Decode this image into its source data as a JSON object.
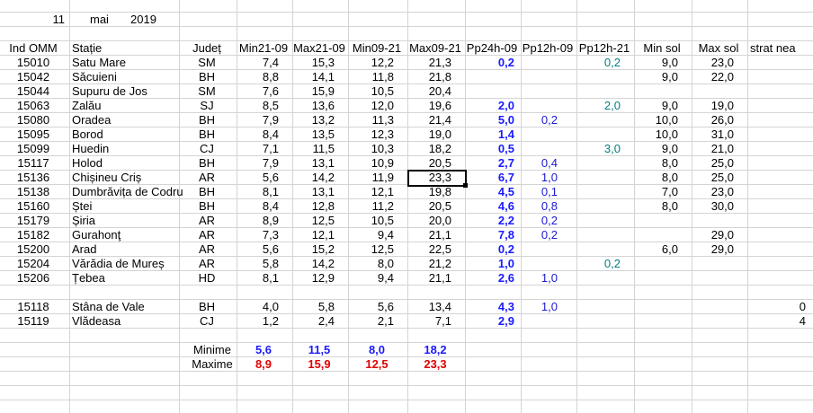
{
  "colors": {
    "gridline": "#d4d4d4",
    "text": "#000000",
    "blue": "#1a1aff",
    "teal": "#008080",
    "darkblue": "#1a1ad0",
    "red": "#e00000"
  },
  "date": {
    "day": "11",
    "month": "mai",
    "year": "2019"
  },
  "headers": [
    "Ind OMM",
    "Stație",
    "Județ",
    "Min21-09",
    "Max21-09",
    "Min09-21",
    "Max09-21",
    "Pp24h-09",
    "Pp12h-09",
    "Pp12h-21",
    "Min sol",
    "Max sol",
    "strat nea"
  ],
  "rows": [
    {
      "ind": "15010",
      "statie": "Satu Mare",
      "judet": "SM",
      "min2109": "7,4",
      "max2109": "15,3",
      "min0921": "12,2",
      "max0921": "21,3",
      "pp24": "0,2",
      "pp12_09": "",
      "pp12_21": "0,2",
      "minsol": "9,0",
      "maxsol": "23,0",
      "nea": ""
    },
    {
      "ind": "15042",
      "statie": "Săcuieni",
      "judet": "BH",
      "min2109": "8,8",
      "max2109": "14,1",
      "min0921": "11,8",
      "max0921": "21,8",
      "pp24": "",
      "pp12_09": "",
      "pp12_21": "",
      "minsol": "9,0",
      "maxsol": "22,0",
      "nea": ""
    },
    {
      "ind": "15044",
      "statie": "Supuru de Jos",
      "judet": "SM",
      "min2109": "7,6",
      "max2109": "15,9",
      "min0921": "10,5",
      "max0921": "20,4",
      "pp24": "",
      "pp12_09": "",
      "pp12_21": "",
      "minsol": "",
      "maxsol": "",
      "nea": ""
    },
    {
      "ind": "15063",
      "statie": "Zalău",
      "judet": "SJ",
      "min2109": "8,5",
      "max2109": "13,6",
      "min0921": "12,0",
      "max0921": "19,6",
      "pp24": "2,0",
      "pp12_09": "",
      "pp12_21": "2,0",
      "minsol": "9,0",
      "maxsol": "19,0",
      "nea": ""
    },
    {
      "ind": "15080",
      "statie": "Oradea",
      "judet": "BH",
      "min2109": "7,9",
      "max2109": "13,2",
      "min0921": "11,3",
      "max0921": "21,4",
      "pp24": "5,0",
      "pp12_09": "0,2",
      "pp12_21": "",
      "minsol": "10,0",
      "maxsol": "26,0",
      "nea": ""
    },
    {
      "ind": "15095",
      "statie": "Borod",
      "judet": "BH",
      "min2109": "8,4",
      "max2109": "13,5",
      "min0921": "12,3",
      "max0921": "19,0",
      "pp24": "1,4",
      "pp12_09": "",
      "pp12_21": "",
      "minsol": "10,0",
      "maxsol": "31,0",
      "nea": ""
    },
    {
      "ind": "15099",
      "statie": "Huedin",
      "judet": "CJ",
      "min2109": "7,1",
      "max2109": "11,5",
      "min0921": "10,3",
      "max0921": "18,2",
      "pp24": "0,5",
      "pp12_09": "",
      "pp12_21": "3,0",
      "minsol": "9,0",
      "maxsol": "21,0",
      "nea": ""
    },
    {
      "ind": "15117",
      "statie": "Holod",
      "judet": "BH",
      "min2109": "7,9",
      "max2109": "13,1",
      "min0921": "10,9",
      "max0921": "20,5",
      "pp24": "2,7",
      "pp12_09": "0,4",
      "pp12_21": "",
      "minsol": "8,0",
      "maxsol": "25,0",
      "nea": ""
    },
    {
      "ind": "15136",
      "statie": "Chișineu    Criș",
      "judet": "AR",
      "min2109": "5,6",
      "max2109": "14,2",
      "min0921": "11,9",
      "max0921": "23,3",
      "pp24": "6,7",
      "pp12_09": "1,0",
      "pp12_21": "",
      "minsol": "8,0",
      "maxsol": "25,0",
      "nea": ""
    },
    {
      "ind": "15138",
      "statie": "Dumbrăvița de Codru",
      "judet": "BH",
      "min2109": "8,1",
      "max2109": "13,1",
      "min0921": "12,1",
      "max0921": "19,8",
      "pp24": "4,5",
      "pp12_09": "0,1",
      "pp12_21": "",
      "minsol": "7,0",
      "maxsol": "23,0",
      "nea": ""
    },
    {
      "ind": "15160",
      "statie": "Ștei",
      "judet": "BH",
      "min2109": "8,4",
      "max2109": "12,8",
      "min0921": "11,2",
      "max0921": "20,5",
      "pp24": "4,6",
      "pp12_09": "0,8",
      "pp12_21": "",
      "minsol": "8,0",
      "maxsol": "30,0",
      "nea": ""
    },
    {
      "ind": "15179",
      "statie": "Șiria",
      "judet": "AR",
      "min2109": "8,9",
      "max2109": "12,5",
      "min0921": "10,5",
      "max0921": "20,0",
      "pp24": "2,2",
      "pp12_09": "0,2",
      "pp12_21": "",
      "minsol": "",
      "maxsol": "",
      "nea": ""
    },
    {
      "ind": "15182",
      "statie": "Gurahonţ",
      "judet": "AR",
      "min2109": "7,3",
      "max2109": "12,1",
      "min0921": "9,4",
      "max0921": "21,1",
      "pp24": "7,8",
      "pp12_09": "0,2",
      "pp12_21": "",
      "minsol": "",
      "maxsol": "29,0",
      "nea": ""
    },
    {
      "ind": "15200",
      "statie": "Arad",
      "judet": "AR",
      "min2109": "5,6",
      "max2109": "15,2",
      "min0921": "12,5",
      "max0921": "22,5",
      "pp24": "0,2",
      "pp12_09": "",
      "pp12_21": "",
      "minsol": "6,0",
      "maxsol": "29,0",
      "nea": ""
    },
    {
      "ind": "15204",
      "statie": "Vărădia de Mureș",
      "judet": "AR",
      "min2109": "5,8",
      "max2109": "14,2",
      "min0921": "8,0",
      "max0921": "21,2",
      "pp24": "1,0",
      "pp12_09": "",
      "pp12_21": "0,2",
      "minsol": "",
      "maxsol": "",
      "nea": ""
    },
    {
      "ind": "15206",
      "statie": "Țebea",
      "judet": "HD",
      "min2109": "8,1",
      "max2109": "12,9",
      "min0921": "9,4",
      "max0921": "21,1",
      "pp24": "2,6",
      "pp12_09": "1,0",
      "pp12_21": "",
      "minsol": "",
      "maxsol": "",
      "nea": ""
    }
  ],
  "mountain_rows": [
    {
      "ind": "15118",
      "statie": "Stâna de Vale",
      "judet": "BH",
      "min2109": "4,0",
      "max2109": "5,8",
      "min0921": "5,6",
      "max0921": "13,4",
      "pp24": "4,3",
      "pp12_09": "1,0",
      "pp12_21": "",
      "minsol": "",
      "maxsol": "",
      "nea": "0"
    },
    {
      "ind": "15119",
      "statie": "Vlădeasa",
      "judet": "CJ",
      "min2109": "1,2",
      "max2109": "2,4",
      "min0921": "2,1",
      "max0921": "7,1",
      "pp24": "2,9",
      "pp12_09": "",
      "pp12_21": "",
      "minsol": "",
      "maxsol": "",
      "nea": "4"
    }
  ],
  "summary": {
    "minime": {
      "label": "Minime",
      "values": [
        "5,6",
        "11,5",
        "8,0",
        "18,2"
      ]
    },
    "maxime": {
      "label": "Maxime",
      "values": [
        "8,9",
        "15,9",
        "12,5",
        "23,3"
      ]
    }
  }
}
